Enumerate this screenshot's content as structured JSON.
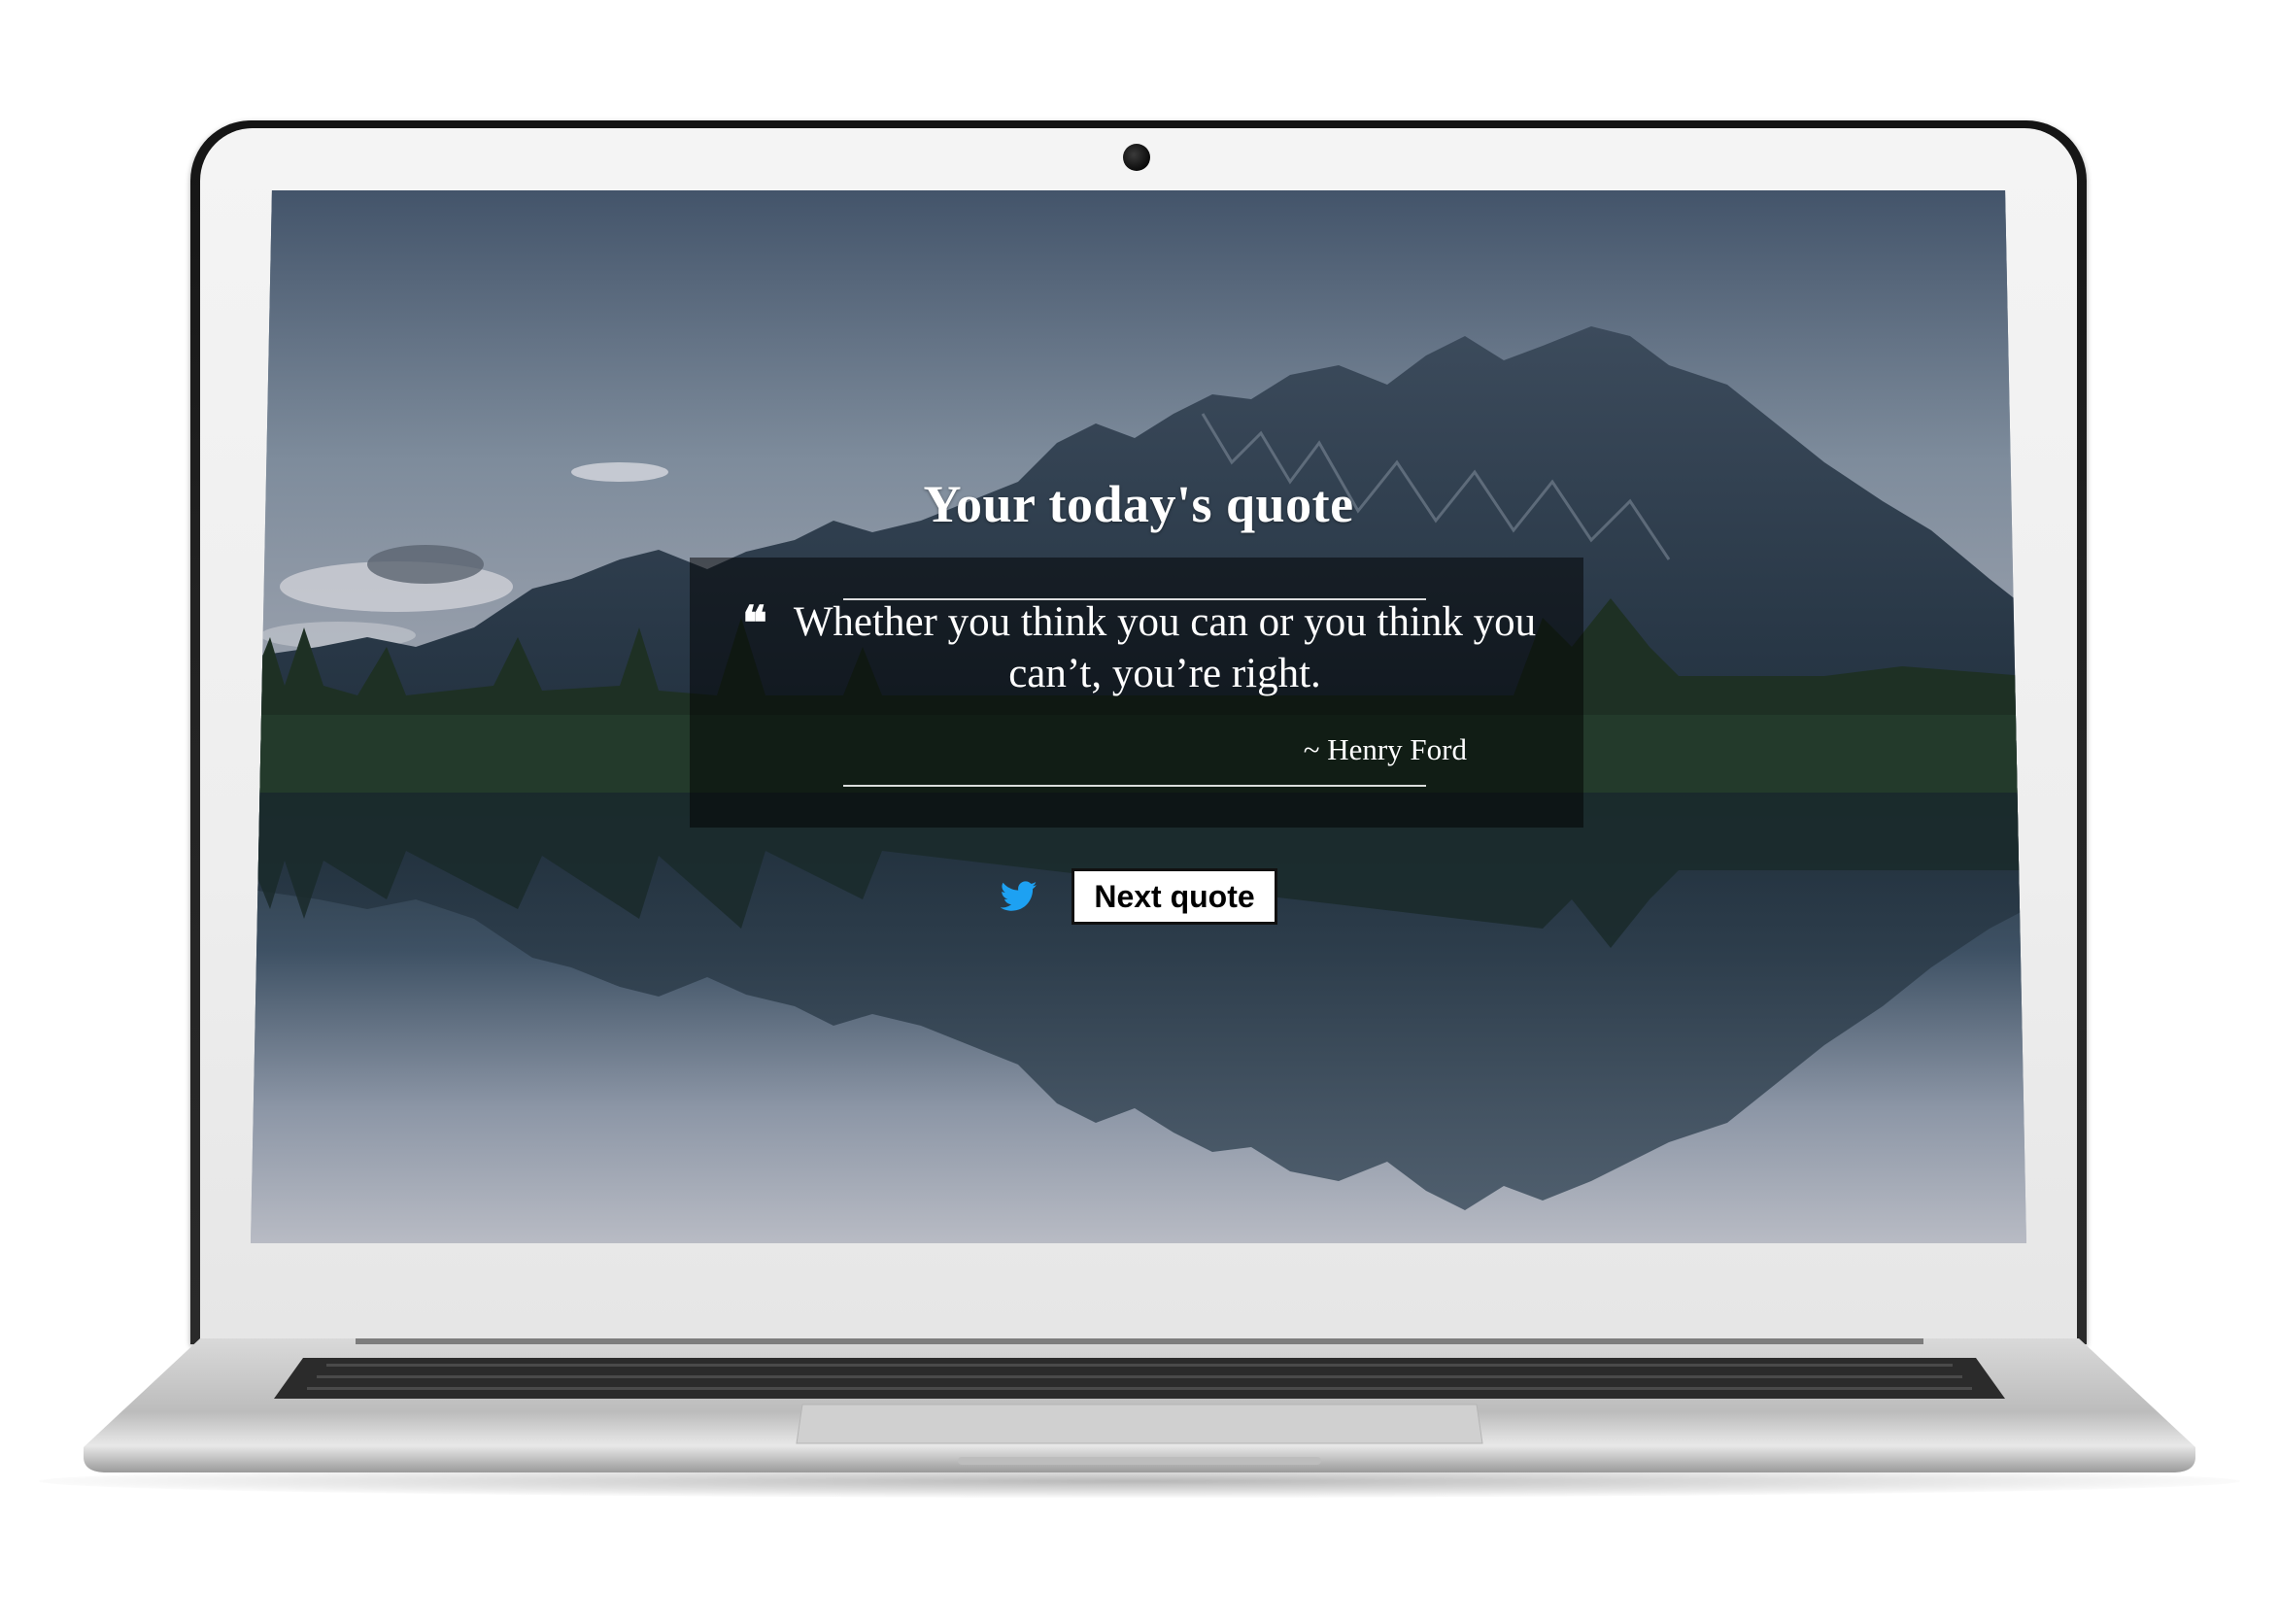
{
  "page": {
    "heading": "Your today's quote"
  },
  "quote": {
    "mark": "❝",
    "text": "Whether you think you can or you think you can’t, you’re right.",
    "author": "~ Henry Ford"
  },
  "actions": {
    "tweet_icon": "twitter-bird-icon",
    "next_label": "Next quote"
  },
  "colors": {
    "twitter_blue": "#1da1f2",
    "quote_box_background": "rgba(0,0,0,0.5)",
    "text": "#ffffff"
  }
}
